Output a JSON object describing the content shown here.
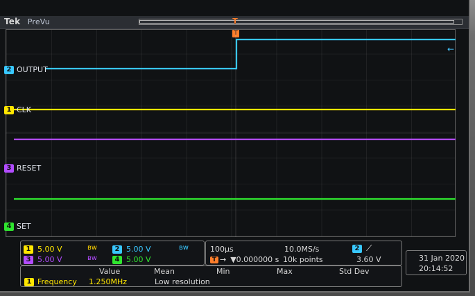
{
  "brand": {
    "name": "Tek",
    "mode": "PreVu"
  },
  "colors": {
    "ch1": "#ffe600",
    "ch2": "#38c7ff",
    "ch3": "#b24cff",
    "ch4": "#2fe52f",
    "trigger": "#ff7e2b"
  },
  "channels": {
    "ch1": {
      "label": "CLK"
    },
    "ch2": {
      "label": "OUTPUT"
    },
    "ch3": {
      "label": "RESET"
    },
    "ch4": {
      "label": "SET"
    }
  },
  "status": {
    "left": {
      "ch1_scale": "5.00 V",
      "ch2_scale": "5.00 V",
      "ch3_scale": "5.00 V",
      "ch4_scale": "5.00 V"
    },
    "mid": {
      "timebase": "100µs",
      "sample_rate": "10.0MS/s",
      "trigger_position": "▼0.000000 s",
      "record_length": "10k points",
      "trigger_channel": "2",
      "trigger_level": "3.60 V"
    },
    "date": {
      "date": "31 Jan 2020",
      "time": "20:14:52"
    }
  },
  "measurements": {
    "headers": {
      "value": "Value",
      "mean": "Mean",
      "min": "Min",
      "max": "Max",
      "std_dev": "Std Dev"
    },
    "rows": [
      {
        "source": "1",
        "name": "Frequency",
        "value": "1.250MHz",
        "mean": "Low resolution"
      }
    ]
  },
  "markers": {
    "trigger_top": "T",
    "trigger_box": "T"
  },
  "icons": {
    "trigger_slope": "rising-edge-icon",
    "bandwidth_limit": "bandwidth-limit-icon",
    "trigger_position": "trigger-position-icon"
  }
}
